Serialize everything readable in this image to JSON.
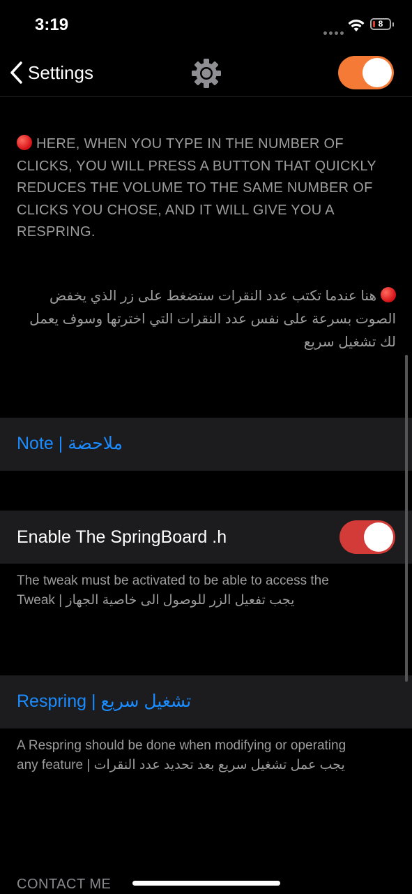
{
  "status_bar": {
    "time": "3:19",
    "battery_level": "8",
    "icons": [
      "signal-dots-icon",
      "wifi-icon",
      "battery-icon"
    ]
  },
  "nav": {
    "back_label": "Settings",
    "center_icon": "gear-icon",
    "toggle_on": true,
    "toggle_color": "#f47a35"
  },
  "description_en": "HERE, WHEN YOU TYPE IN THE NUMBER OF CLICKS, YOU WILL PRESS A BUTTON THAT QUICKLY REDUCES THE VOLUME TO THE SAME NUMBER OF CLICKS YOU CHOSE, AND IT WILL GIVE YOU A RESPRING.",
  "description_ar": "هنا عندما تكتب عدد النقرات ستضغط على زر الذي يخفض الصوت بسرعة على نفس عدد النقرات التي اخترتها وسوف يعمل لك تشغيل سريع",
  "note_link": "Note | ملاحضة",
  "enable": {
    "label": "Enable The SpringBoard .h",
    "toggle_on": true,
    "toggle_color": "#d23b37"
  },
  "enable_footer_line1": "The tweak must be activated to be able to access the",
  "enable_footer_line2": "Tweak | يجب تفعيل الزر للوصول الى خاصية الجهاز",
  "respring_link": "Respring | تشغيل سريع",
  "respring_footer_line1": "A Respring should be done when modifying or operating",
  "respring_footer_line2": "any feature | يجب عمل تشغيل سريع بعد تحديد عدد النقرات",
  "contact_header": "CONTACT ME",
  "colors": {
    "background": "#000000",
    "cell": "#1c1c1e",
    "link": "#1a8cff",
    "secondary_text": "#9d9d9d"
  }
}
